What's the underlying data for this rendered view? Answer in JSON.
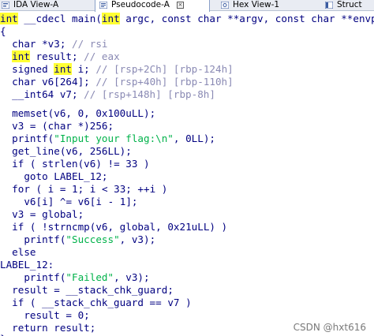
{
  "tabs": [
    {
      "label": "IDA View-A"
    },
    {
      "label": "Pseudocode-A",
      "close": "×"
    },
    {
      "label": "Hex View-1"
    },
    {
      "label": "Struct"
    }
  ],
  "code": {
    "sig_kw": "int",
    "sig_mid": " __cdecl main(",
    "sig_kw2": "int",
    "sig_rest": " argc, const char **argv, const char **envp)",
    "open_brace": "{",
    "l_v3": "  char *v3; ",
    "l_v3_c": "// rsi",
    "l_result_kw": "int",
    "l_result": " result; ",
    "l_result_c": "// eax",
    "l_i_a": "  signed ",
    "l_i_kw": "int",
    "l_i_b": " i; ",
    "l_i_c": "// [rsp+2Ch] [rbp-124h]",
    "l_v6": "  char v6[264]; ",
    "l_v6_c": "// [rsp+40h] [rbp-110h]",
    "l_v7": "  __int64 v7; ",
    "l_v7_c": "// [rsp+148h] [rbp-8h]",
    "memset_a": "  memset(",
    "memset_v": "v6",
    "memset_b": ", 0, 0x100uLL);",
    "v3_a": "  v3",
    "v3_b": " = (char *)256;",
    "printf1_a": "  printf(",
    "printf1_lit": "\"Input your flag:\\n\"",
    "printf1_b": ", 0LL);",
    "getline_a": "  get_line(",
    "getline_v": "v6",
    "getline_b": ", 256LL);",
    "if1_a": "  if ( strlen(",
    "if1_v": "v6",
    "if1_b": ") != 33 )",
    "goto": "    goto LABEL_12;",
    "for_a": "  for ( ",
    "for_i1": "i",
    "for_b": " = 1; ",
    "for_i2": "i",
    "for_c": " < 33; ++",
    "for_i3": "i",
    "for_d": " )",
    "xor_a": "    ",
    "xor_v1": "v6",
    "xor_b": "[",
    "xor_i1": "i",
    "xor_c": "] ^= ",
    "xor_v2": "v6",
    "xor_d": "[",
    "xor_i2": "i",
    "xor_e": " - 1];",
    "v3g_a": "  v3",
    "v3g_b": " = global;",
    "if2_a": "  if ( !strncmp(",
    "if2_v": "v6",
    "if2_b": ", global, 0x21uLL) )",
    "succ_a": "    printf(",
    "succ_lit": "\"Success\"",
    "succ_b": ", ",
    "succ_v": "v3",
    "succ_c": ");",
    "else": "  else",
    "label": "LABEL_12:",
    "fail_a": "    printf(",
    "fail_lit": "\"Failed\"",
    "fail_b": ", ",
    "fail_v": "v3",
    "fail_c": ");",
    "res_v": "  result",
    "res_b": " = __stack_chk_guard;",
    "if3_a": "  if ( __stack_chk_guard == ",
    "if3_v": "v7",
    "if3_b": " )",
    "res0_v": "    result",
    "res0_b": " = 0;",
    "ret_a": "  return ",
    "ret_v": "result",
    "ret_b": ";",
    "close_brace": "}"
  },
  "watermark": "CSDN @hxt616",
  "colors": {
    "code": "#000080",
    "comment": "#8a8ab4",
    "string": "#00b24a",
    "highlight": "#ffff33"
  }
}
